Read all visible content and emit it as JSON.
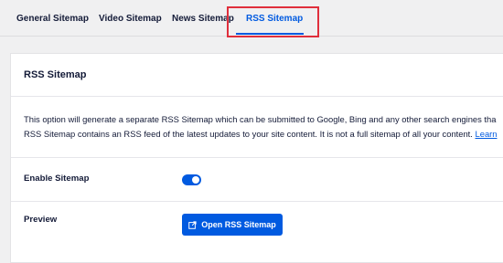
{
  "tabs": [
    {
      "label": "General Sitemap"
    },
    {
      "label": "Video Sitemap"
    },
    {
      "label": "News Sitemap"
    },
    {
      "label": "RSS Sitemap",
      "active": true
    }
  ],
  "card": {
    "title": "RSS Sitemap",
    "description_line1": "This option will generate a separate RSS Sitemap which can be submitted to Google, Bing and any other search engines tha",
    "description_line2": "RSS Sitemap contains an RSS feed of the latest updates to your site content. It is not a full sitemap of all your content.",
    "description_link": "Learn"
  },
  "settings": {
    "enable_label": "Enable Sitemap",
    "enabled": true,
    "preview_label": "Preview",
    "open_button_label": "Open RSS Sitemap"
  },
  "colors": {
    "accent": "#005ae0",
    "highlight": "#e02f3c",
    "text": "#141b38"
  },
  "icons": {
    "open_button_icon": "external-link-icon"
  }
}
